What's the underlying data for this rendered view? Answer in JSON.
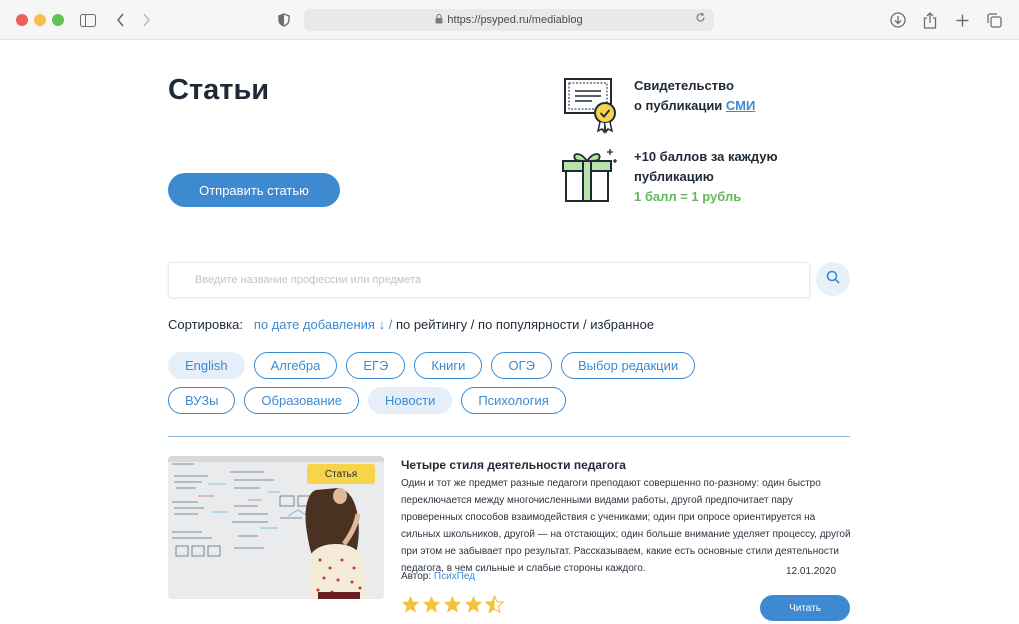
{
  "browser": {
    "url": "https://psyped.ru/mediablog"
  },
  "page": {
    "title": "Статьи",
    "send_button": "Отправить статью"
  },
  "promos": [
    {
      "line1": "Свидетельство",
      "line2": "о публикации ",
      "link": "СМИ"
    },
    {
      "line1": "+10 баллов за каждую",
      "line2": "публикацию",
      "line3": "1 балл = 1 рубль"
    }
  ],
  "search": {
    "placeholder": "Введите название профессии или предмета"
  },
  "sort": {
    "label": "Сортировка:",
    "active": "по дате добавления ↓",
    "separator": " / ",
    "options": [
      "по рейтингу",
      "по популярности",
      "избранное"
    ]
  },
  "tags": {
    "row1": [
      {
        "label": "English",
        "selected": true
      },
      {
        "label": "Алгебра",
        "selected": false
      },
      {
        "label": "ЕГЭ",
        "selected": false
      },
      {
        "label": "Книги",
        "selected": false
      },
      {
        "label": "ОГЭ",
        "selected": false
      },
      {
        "label": "Выбор редакции",
        "selected": false
      }
    ],
    "row2": [
      {
        "label": "ВУЗы",
        "selected": false
      },
      {
        "label": "Образование",
        "selected": false
      },
      {
        "label": "Новости",
        "selected": true
      },
      {
        "label": "Психология",
        "selected": false
      }
    ]
  },
  "article": {
    "badge": "Статья",
    "title": "Четыре стиля деятельности педагога",
    "text": "Один и тот же предмет разные педагоги преподают совершенно по-разному: один быстро переключается между многочисленными видами работы, другой предпочитает пару проверенных способов взаимодействия с учениками; один при опросе ориентируется на сильных школьников, другой — на отстающих; один больше внимание уделяет процессу, другой при этом не забывает про результат. Рассказываем, какие есть основные стили деятельности педагога, в чем сильные и слабые стороны каждого.",
    "author_label": "Автор: ",
    "author": "ПсихПед",
    "date": "12.01.2020",
    "rating": 4.5,
    "read_button": "Читать"
  },
  "colors": {
    "accent": "#3d8ad1",
    "badge": "#f7d44a",
    "star": "#f5c23d",
    "green": "#66b75b"
  }
}
